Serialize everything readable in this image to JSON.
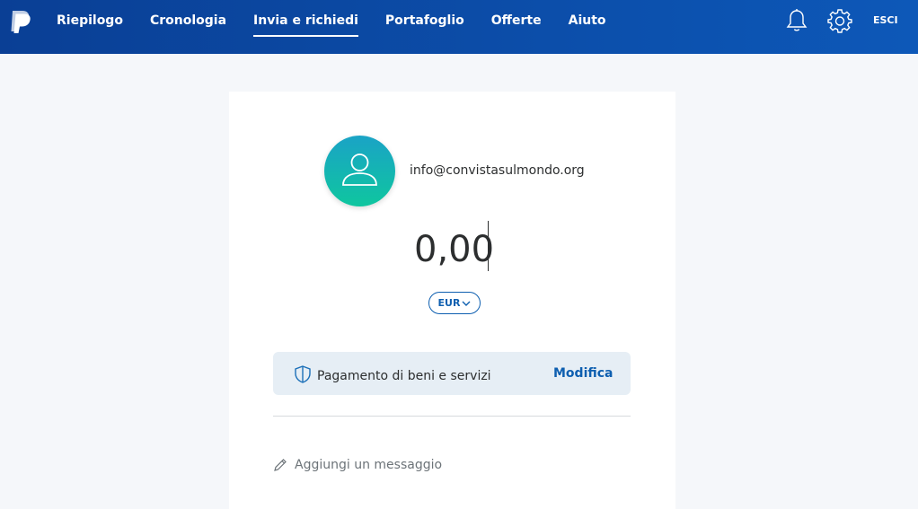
{
  "header": {
    "nav": [
      {
        "label": "Riepilogo",
        "active": false
      },
      {
        "label": "Cronologia",
        "active": false
      },
      {
        "label": "Invia e richiedi",
        "active": true
      },
      {
        "label": "Portafoglio",
        "active": false
      },
      {
        "label": "Offerte",
        "active": false
      },
      {
        "label": "Aiuto",
        "active": false
      }
    ],
    "logout_label": "ESCI",
    "icons": [
      "paypal-logo",
      "bell-icon",
      "gear-icon"
    ],
    "colors": {
      "bar_start": "#0a3f95",
      "bar_end": "#0d58b8"
    }
  },
  "send": {
    "recipient": "info@convistasulmondo.org",
    "amount": "0,00",
    "currency": "EUR",
    "payment_type_label": "Pagamento di beni e servizi",
    "modify_label": "Modifica",
    "message_placeholder": "Aggiungi un messaggio",
    "colors": {
      "accent": "#0e5fb0",
      "avatar_top": "#1aa3c6",
      "avatar_bottom": "#0fc69f",
      "panel": "#e6eef5"
    }
  }
}
